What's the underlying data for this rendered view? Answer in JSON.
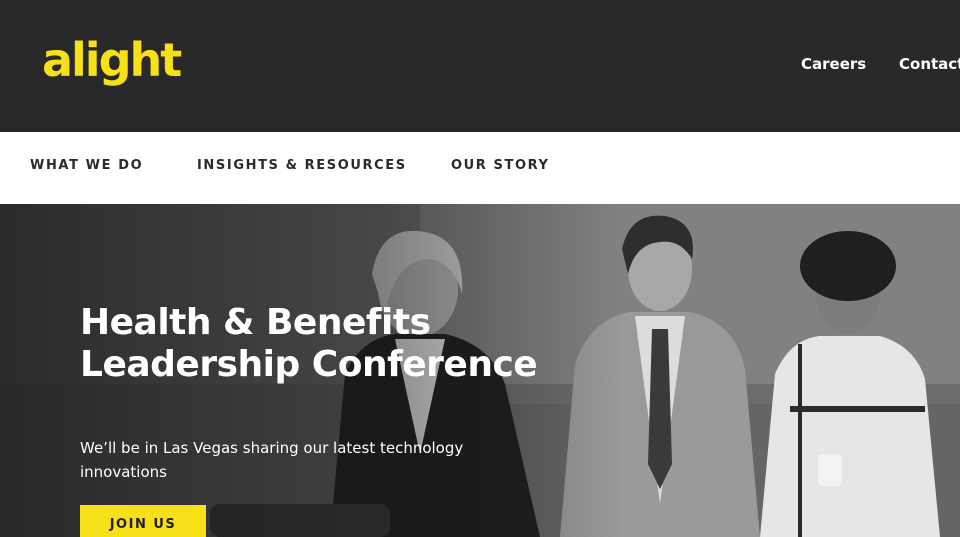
{
  "brand": {
    "logo_text": "alight",
    "accent_color": "#f7e017"
  },
  "utility_nav": {
    "careers_label": "Careers",
    "contact_label": "Contact"
  },
  "main_nav": {
    "items": [
      {
        "label": "WHAT WE DO"
      },
      {
        "label": "INSIGHTS & RESOURCES"
      },
      {
        "label": "OUR STORY"
      }
    ]
  },
  "hero": {
    "title": "Health & Benefits Leadership Conference",
    "subtitle": "We’ll be in Las Vegas sharing our latest technology innovations",
    "cta_label": "JOIN US"
  }
}
